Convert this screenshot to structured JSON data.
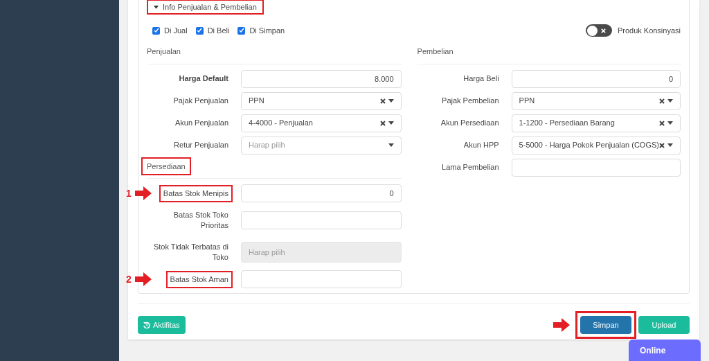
{
  "section": {
    "title": "Info Penjualan & Pembelian",
    "expanded": true,
    "highlighted": true
  },
  "checkboxes": [
    {
      "label": "Di Jual",
      "checked": true
    },
    {
      "label": "Di Beli",
      "checked": true
    },
    {
      "label": "Di Simpan",
      "checked": true
    }
  ],
  "toggle": {
    "label": "Produk Konsinyasi",
    "on": false
  },
  "penjualan": {
    "title": "Penjualan",
    "fields": [
      {
        "label": "Harga Default",
        "bold": true,
        "kind": "number",
        "value": "8.000"
      },
      {
        "label": "Pajak Penjualan",
        "kind": "select",
        "value": "PPN",
        "clearable": true
      },
      {
        "label": "Akun Penjualan",
        "kind": "select",
        "value": "4-4000 - Penjualan",
        "clearable": true
      },
      {
        "label": "Retur Penjualan",
        "kind": "select",
        "placeholder": "Harap pilih",
        "clearable": false
      }
    ]
  },
  "persediaan": {
    "title": "Persediaan",
    "highlighted": true,
    "fields": [
      {
        "label": "Batas Stok Menipis",
        "kind": "number",
        "value": "0",
        "highlighted": true,
        "annotation": "1"
      },
      {
        "label": "Batas Stok Toko Prioritas",
        "kind": "number",
        "highlighted": false
      },
      {
        "label": "Stok Tidak Terbatas di Toko",
        "kind": "disabled",
        "placeholder": "Harap pilih",
        "highlighted": false
      },
      {
        "label": "Batas Stok Aman",
        "kind": "number",
        "highlighted": true,
        "annotation": "2"
      }
    ]
  },
  "pembelian": {
    "title": "Pembelian",
    "fields": [
      {
        "label": "Harga Beli",
        "kind": "number",
        "value": "0"
      },
      {
        "label": "Pajak Pembelian",
        "kind": "select",
        "value": "PPN",
        "clearable": true
      },
      {
        "label": "Akun Persediaan",
        "kind": "select",
        "value": "1-1200 - Persediaan Barang",
        "clearable": true
      },
      {
        "label": "Akun HPP",
        "kind": "select",
        "value": "5-5000 - Harga Pokok Penjualan (COGS)",
        "clearable": true
      },
      {
        "label": "Lama Pembelian",
        "kind": "number"
      }
    ]
  },
  "footer": {
    "activity_button": "Aktifitas",
    "save_button": {
      "label": "Simpan",
      "highlighted": true
    },
    "upload_button": "Upload"
  },
  "status_badge": "Online"
}
